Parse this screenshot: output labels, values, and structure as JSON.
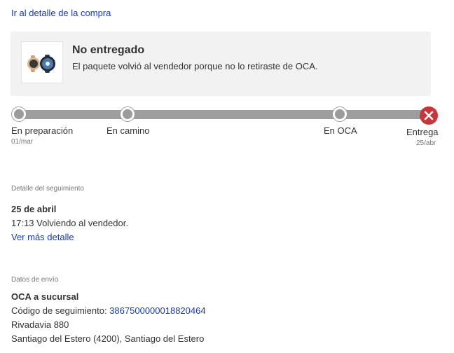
{
  "top_link": "Ir al detalle de la compra",
  "status": {
    "title": "No entregado",
    "description": "El paquete volvió al vendedor porque no lo retiraste de OCA."
  },
  "tracker": {
    "steps": [
      {
        "label": "En preparación",
        "date": "01/mar"
      },
      {
        "label": "En camino",
        "date": ""
      },
      {
        "label": "En OCA",
        "date": ""
      },
      {
        "label": "Entrega",
        "date": "25/abr"
      }
    ]
  },
  "tracking_detail": {
    "caption": "Detalle del seguimiento",
    "date": "25 de abril",
    "event": "17:13 Volviendo al vendedor.",
    "more_link": "Ver más detalle"
  },
  "shipping": {
    "caption": "Datos de envío",
    "method": "OCA a sucursal",
    "tracking_label": "Código de seguimiento: ",
    "tracking_number": "3867500000018820464",
    "address_line1": "Rivadavia 880",
    "address_line2": "Santiago del Estero (4200), Santiago del Estero"
  },
  "colors": {
    "link": "#1a3c9e",
    "track": "#9e9e9e",
    "failed": "#c9353d",
    "card_bg": "#f2f2f2"
  },
  "icons": {
    "product": "smartwatch-thumbnail",
    "failed_step": "close-icon"
  }
}
